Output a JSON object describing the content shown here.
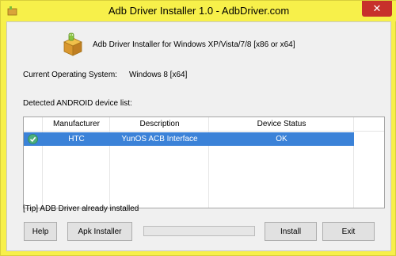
{
  "window": {
    "title": "Adb Driver Installer 1.0  -  AdbDriver.com",
    "close_label": "✕"
  },
  "header": {
    "text": "Adb Driver Installer for Windows XP/Vista/7/8 [x86 or x64]"
  },
  "os": {
    "label": "Current Operating System:",
    "value": "Windows 8  [x64]"
  },
  "device_list": {
    "label": "Detected ANDROID device list:",
    "columns": [
      "Manufacturer",
      "Description",
      "Device Status"
    ],
    "rows": [
      {
        "manufacturer": "HTC",
        "description": "YunOS ACB Interface",
        "status": "OK",
        "selected": true,
        "icon": "check-icon"
      }
    ]
  },
  "tip": "[Tip] ADB Driver already installed",
  "buttons": {
    "help": "Help",
    "apk_installer": "Apk Installer",
    "install": "Install",
    "exit": "Exit"
  },
  "progress": {
    "value": 0
  },
  "colors": {
    "title_bar": "#f7f04a",
    "selection": "#3b82d8",
    "close_button": "#c7302b",
    "check_icon": "#4caf7d"
  }
}
